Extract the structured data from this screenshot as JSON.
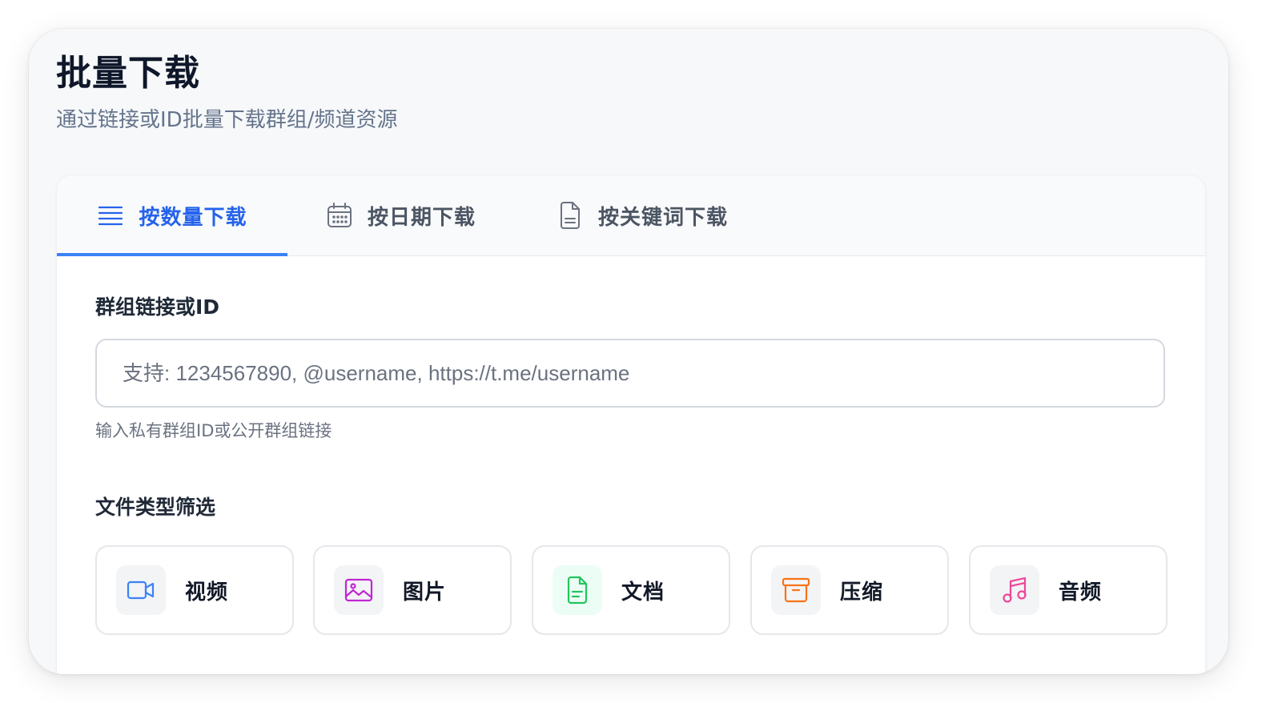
{
  "header": {
    "title": "批量下载",
    "subtitle": "通过链接或ID批量下载群组/频道资源"
  },
  "tabs": [
    {
      "label": "按数量下载",
      "icon": "list-icon",
      "active": true
    },
    {
      "label": "按日期下载",
      "icon": "calendar-icon",
      "active": false
    },
    {
      "label": "按关键词下载",
      "icon": "document-icon",
      "active": false
    }
  ],
  "group_field": {
    "label": "群组链接或ID",
    "value": "",
    "placeholder": "支持: 1234567890, @username, https://t.me/username",
    "hint": "输入私有群组ID或公开群组链接"
  },
  "file_types": {
    "label": "文件类型筛选",
    "items": [
      {
        "label": "视频",
        "icon": "video-icon",
        "color": "#3b82f6"
      },
      {
        "label": "图片",
        "icon": "image-icon",
        "color": "#c026d3"
      },
      {
        "label": "文档",
        "icon": "file-text-icon",
        "color": "#22c55e"
      },
      {
        "label": "压缩",
        "icon": "archive-icon",
        "color": "#f97316"
      },
      {
        "label": "音频",
        "icon": "music-icon",
        "color": "#ec4899"
      }
    ]
  },
  "colors": {
    "accent": "#3b82f6",
    "active_tab_text": "#2563eb"
  }
}
